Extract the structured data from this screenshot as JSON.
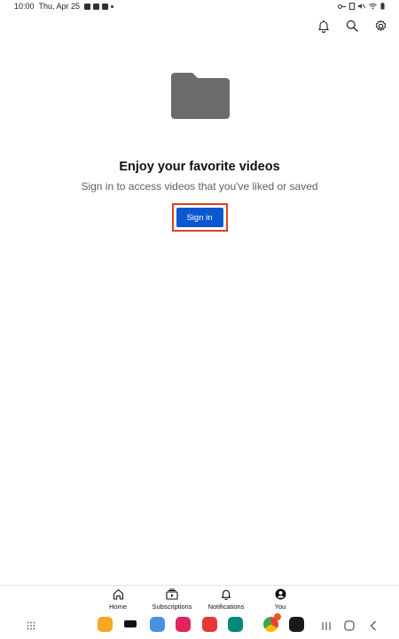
{
  "status_bar": {
    "time": "10:00",
    "date": "Thu, Apr 25"
  },
  "top_actions": {
    "notifications_icon": "bell-icon",
    "search_icon": "search-icon",
    "settings_icon": "gear-icon"
  },
  "empty_state": {
    "illustration": "folder-icon",
    "title": "Enjoy your favorite videos",
    "subtitle": "Sign in to access videos that you've liked or saved",
    "sign_in_label": "Sign in"
  },
  "bottom_nav": {
    "items": [
      {
        "label": "Home",
        "icon": "home-icon"
      },
      {
        "label": "Subscriptions",
        "icon": "subscriptions-icon"
      },
      {
        "label": "Notifications",
        "icon": "bell-icon"
      },
      {
        "label": "You",
        "icon": "account-icon",
        "active": true
      }
    ]
  },
  "colors": {
    "accent": "#0b57d0",
    "highlight_border": "#d9441a",
    "folder": "#6b6b6b",
    "subtitle": "#606060"
  }
}
